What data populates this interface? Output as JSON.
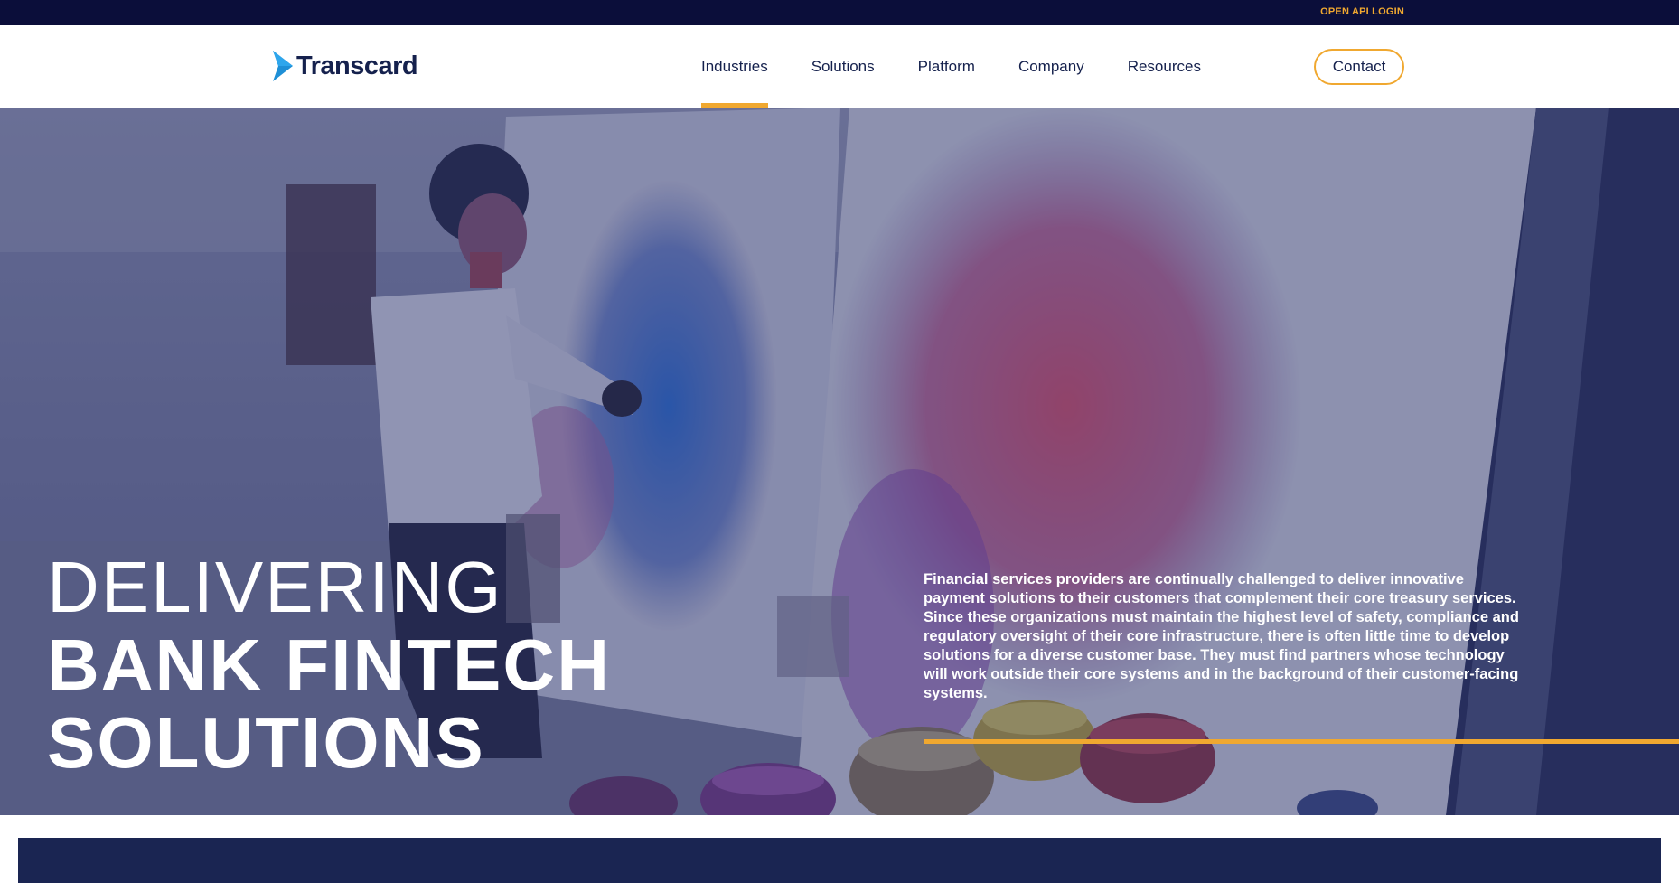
{
  "topbar": {
    "link_label": "OPEN API LOGIN"
  },
  "header": {
    "logo_text": "Transcard",
    "nav": [
      {
        "label": "Industries",
        "active": true
      },
      {
        "label": "Solutions",
        "active": false
      },
      {
        "label": "Platform",
        "active": false
      },
      {
        "label": "Company",
        "active": false
      },
      {
        "label": "Resources",
        "active": false
      }
    ],
    "contact_label": "Contact"
  },
  "hero": {
    "title_line1": "DELIVERING",
    "title_line2": "BANK FINTECH",
    "title_line3": "SOLUTIONS",
    "description": "Financial services providers are continually challenged to deliver innovative payment solutions to their customers that complement their core treasury services. Since these organizations must maintain the highest level of safety, compliance and regulatory oversight of their core infrastructure, there is often little time to develop solutions for a diverse customer base. They must find partners whose technology will work outside their core systems and in the background of their customer-facing systems."
  },
  "colors": {
    "topbar_bg": "#0b0e3a",
    "accent": "#f0a830",
    "brand_navy": "#15214d",
    "logo_blue": "#1e8fd6",
    "band_navy": "#1a2552"
  },
  "icons": {
    "logo_mark": "play-chevron-icon"
  }
}
